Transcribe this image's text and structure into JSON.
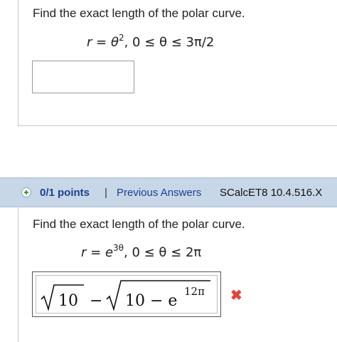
{
  "question1": {
    "prompt": "Find the exact length of the polar curve.",
    "equation_lhs": "r",
    "equation_eq": " = ",
    "equation_var": "θ",
    "equation_exp": "2",
    "interval": ",    0 ≤ θ ≤ 3π/2",
    "answer_value": ""
  },
  "header": {
    "points": "0/1 points",
    "separator": "|",
    "previous_answers": "Previous Answers",
    "source": "SCalcET8 10.4.516.X"
  },
  "question2": {
    "prompt": "Find the exact length of the polar curve.",
    "equation_lhs": "r",
    "equation_eq": " = ",
    "equation_var": "e",
    "equation_exp": "3θ",
    "interval": ",    0 ≤ θ ≤ 2π",
    "answer": {
      "radicand1": "10",
      "minus": "−",
      "radicand2_base": "10 − e",
      "radicand2_exp": "12π"
    }
  },
  "icons": {
    "points_icon": "plus-circle-icon",
    "incorrect_icon": "red-x-icon"
  },
  "colors": {
    "header_bg": "#c7d7e8",
    "link": "#1e3f8f",
    "incorrect": "#e0463a"
  }
}
